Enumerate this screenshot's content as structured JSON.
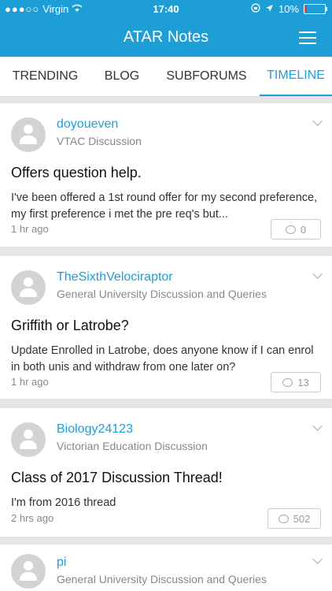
{
  "status_bar": {
    "carrier": "Virgin",
    "signal": "●●●○○",
    "time": "17:40",
    "battery": "10%",
    "battery_level": 0.1
  },
  "header": {
    "title": "ATAR Notes"
  },
  "tabs": [
    {
      "label": "TRENDING"
    },
    {
      "label": "BLOG"
    },
    {
      "label": "SUBFORUMS"
    },
    {
      "label": "TIMELINE",
      "active": true
    }
  ],
  "posts": [
    {
      "username": "doyoueven",
      "forum": "VTAC Discussion",
      "title": "Offers question help.",
      "excerpt": "I've been offered a 1st round offer for my second preference, my first preference i met the pre req's but...",
      "time": "1 hr ago",
      "comments": "0"
    },
    {
      "username": "TheSixthVelociraptor",
      "forum": "General University Discussion and Queries",
      "title": "Griffith or Latrobe?",
      "excerpt": "Update  Enrolled in Latrobe, does anyone know if I can enrol in both unis and withdraw from one later on?",
      "time": "1 hr ago",
      "comments": "13"
    },
    {
      "username": "Biology24123",
      "forum": "Victorian Education Discussion",
      "title": "Class of 2017 Discussion Thread!",
      "excerpt": "I'm from 2016 thread",
      "time": "2 hrs ago",
      "comments": "502"
    },
    {
      "username": "pi",
      "forum": "General University Discussion and Queries"
    }
  ]
}
